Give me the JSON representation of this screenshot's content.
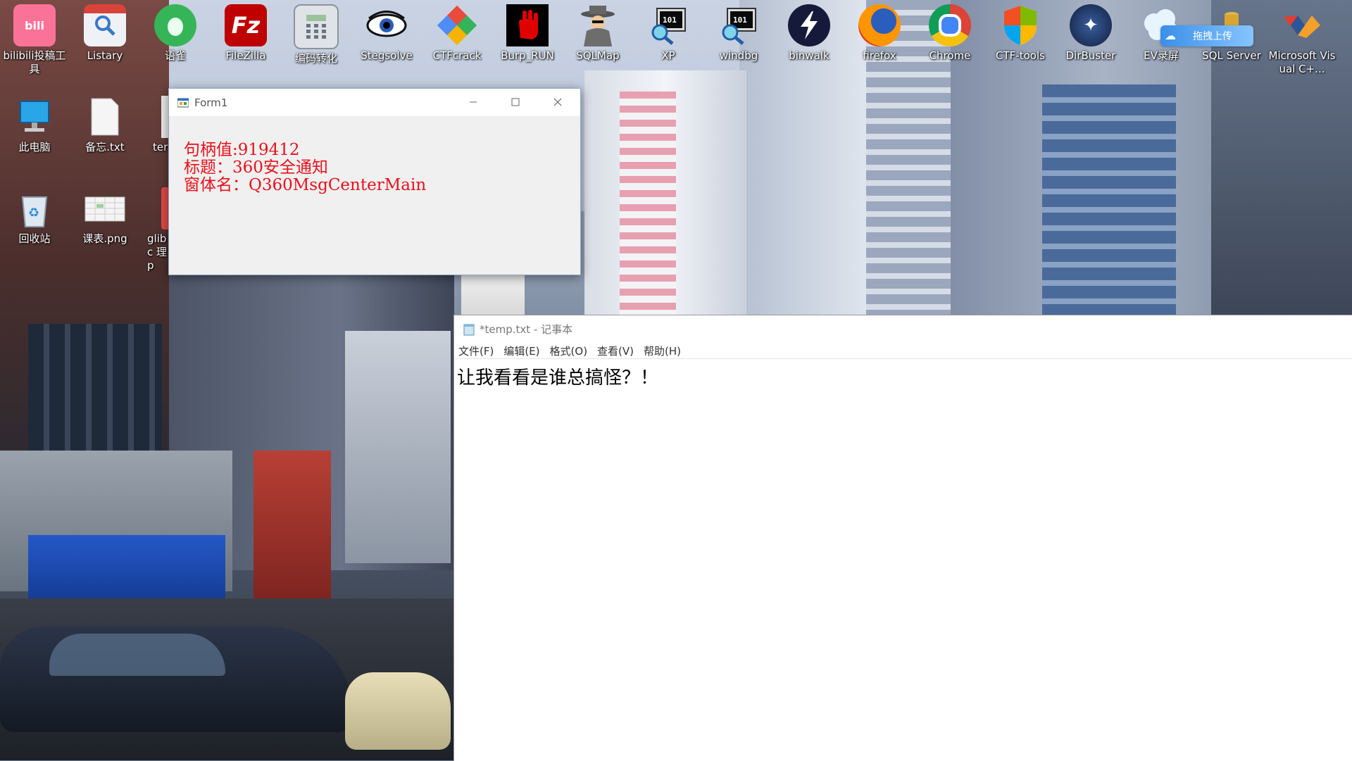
{
  "desktop": {
    "icons": [
      {
        "label": "bilibili投稿工具",
        "icon": "bilibili-icon"
      },
      {
        "label": "Listary",
        "icon": "listary-icon"
      },
      {
        "label": "语雀",
        "icon": "yuque-icon"
      },
      {
        "label": "FileZilla",
        "icon": "filezilla-icon"
      },
      {
        "label": "编码转化",
        "icon": "calculator-icon"
      },
      {
        "label": "Stegsolve",
        "icon": "eye-icon"
      },
      {
        "label": "CTFcrack",
        "icon": "ctfcrack-icon"
      },
      {
        "label": "Burp_RUN",
        "icon": "hand-icon"
      },
      {
        "label": "SQLMap",
        "icon": "detective-icon"
      },
      {
        "label": "XP",
        "icon": "debugger-icon"
      },
      {
        "label": "windbg",
        "icon": "debugger-icon"
      },
      {
        "label": "binwalk",
        "icon": "lightning-icon"
      },
      {
        "label": "firefox",
        "icon": "firefox-icon"
      },
      {
        "label": "Chrome",
        "icon": "chrome-icon"
      },
      {
        "label": "CTF-tools",
        "icon": "shield-icon"
      },
      {
        "label": "DirBuster",
        "icon": "dirbuster-icon"
      },
      {
        "label": "EV录屏",
        "icon": "recorder-icon"
      },
      {
        "label": "SQL Server",
        "icon": "database-icon"
      },
      {
        "label": "Microsoft Visual C+...",
        "icon": "visual-cpp-icon"
      },
      {
        "label": "此电脑",
        "icon": "computer-icon"
      },
      {
        "label": "备忘.txt",
        "icon": "text-file-icon"
      },
      {
        "label": "ter",
        "icon": "file-icon"
      },
      {
        "label": "回收站",
        "icon": "recycle-bin-icon"
      },
      {
        "label": "课表.png",
        "icon": "image-file-icon"
      },
      {
        "label": "glibc 理p",
        "icon": "file-icon"
      }
    ],
    "upload_badge": "拖拽上传"
  },
  "form1": {
    "title": "Form1",
    "lines": [
      "句柄值:919412",
      "标题：360安全通知",
      "窗体名：Q360MsgCenterMain"
    ]
  },
  "notepad": {
    "title": "*temp.txt - 记事本",
    "menu": [
      "文件(F)",
      "编辑(E)",
      "格式(O)",
      "查看(V)",
      "帮助(H)"
    ],
    "text": "让我看看是谁总搞怪？！"
  },
  "colors": {
    "form_text": "#e8101a",
    "window_border": "#8fa8c4"
  }
}
